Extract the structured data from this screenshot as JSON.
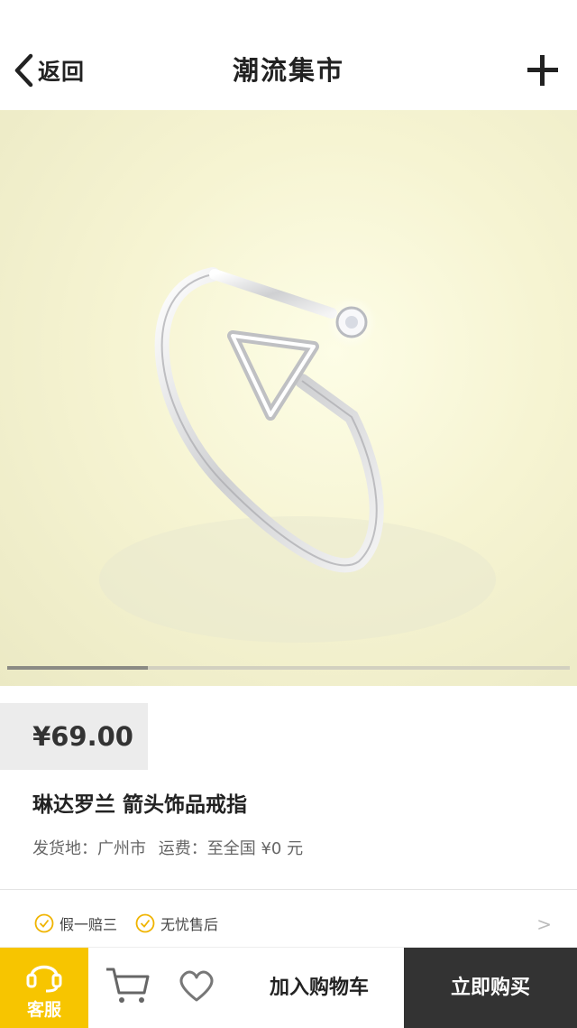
{
  "header": {
    "back_label": "返回",
    "title": "潮流集市"
  },
  "gallery": {
    "current_fraction": 0.25
  },
  "product": {
    "price": "¥69.00",
    "name": "琳达罗兰 箭头饰品戒指",
    "ship_origin": "发货地：广州市",
    "shipping_fee": "运费：至全国 ¥0 元"
  },
  "guarantees": [
    "假一赔三",
    "无忧售后"
  ],
  "bottom_bar": {
    "service_label": "客服",
    "add_to_cart_label": "加入购物车",
    "buy_now_label": "立即购买"
  },
  "colors": {
    "accent": "#f7c500",
    "buy_bg": "#333333",
    "check": "#f0b400"
  }
}
